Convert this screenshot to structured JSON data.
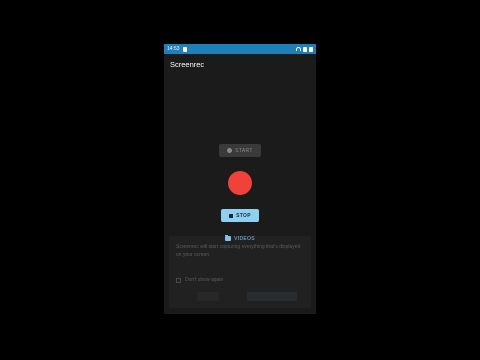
{
  "status_bar": {
    "time": "14:53"
  },
  "app_bar": {
    "title": "Screenrec"
  },
  "controls": {
    "start_label": "START",
    "stop_label": "STOP",
    "videos_label": "VIDEOS",
    "record_color": "#f0413a",
    "stop_color": "#8fd0f2"
  },
  "dialog": {
    "message": "Screenrec will start capturing everything that's displayed on your screen.",
    "checkbox_label": "Don't show again"
  }
}
